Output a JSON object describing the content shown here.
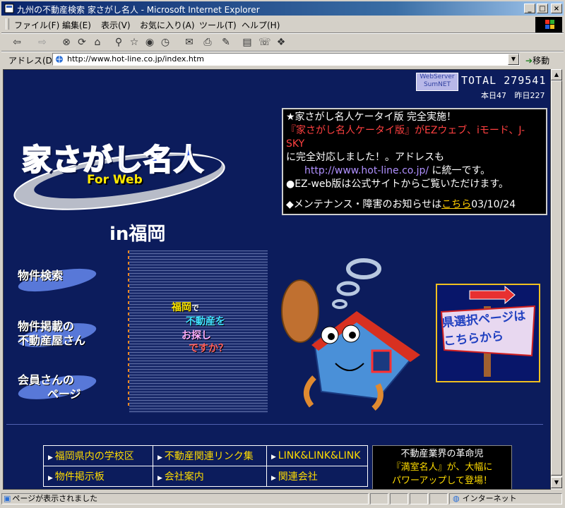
{
  "window": {
    "title": "九州の不動産検索 家さがし名人 - Microsoft Internet Explorer"
  },
  "menu": [
    "ファイル(F)",
    "編集(E)",
    "表示(V)",
    "お気に入り(A)",
    "ツール(T)",
    "ヘルプ(H)"
  ],
  "address": {
    "label": "アドレス(D)",
    "url": "http://www.hot-line.co.jp/index.htm",
    "go_label": "移動"
  },
  "page": {
    "badge": "WebServer SumNET",
    "total_label": "TOTAL",
    "total_value": "279541",
    "today": "本日47",
    "yesterday": "昨日227",
    "logo_title": "家さがし名人",
    "logo_sub": "For Web",
    "place": "in福岡",
    "notice": {
      "line1": "★家さがし名人ケータイ版 完全実施！",
      "line2": "『家さがし名人ケータイ版』がEZウェブ、iモード、J-SKY",
      "line3": "に完全対応しました！。アドレスも",
      "url": "http://www.hot-line.co.jp/",
      "url_suffix": "に統一です。",
      "line4": "●EZ-web版は公式サイトからご覧いただけます。",
      "line5_prefix": "◆メンテナンス・障害のお知らせは",
      "line5_link": "こちら",
      "line5_date": "03/10/24"
    },
    "nav": {
      "search": "物件検索",
      "listing_line1": "物件掲載の",
      "listing_line2": "不動産屋さん",
      "member_line1": "会員さんの",
      "member_line2": "ページ"
    },
    "catch": {
      "w1": "福岡",
      "w1b": "で",
      "w2": "不動産",
      "w2b": "を",
      "w3": "お探し",
      "w4": "ですか？"
    },
    "pref_sign": {
      "line1": "県選択ページは",
      "line2": "こちらから"
    },
    "links": [
      [
        "福岡県内の学校区",
        "不動産関連リンク集",
        "LINK&LINK&LINK"
      ],
      [
        "物件掲示板",
        "会社案内",
        "関連会社"
      ]
    ],
    "ad": {
      "line1": "不動産業界の革命児",
      "line2": "『満室名人』が、大幅に",
      "line3": "パワーアップして登場！"
    }
  },
  "status": {
    "text": "ページが表示されました",
    "zone": "インターネット"
  }
}
